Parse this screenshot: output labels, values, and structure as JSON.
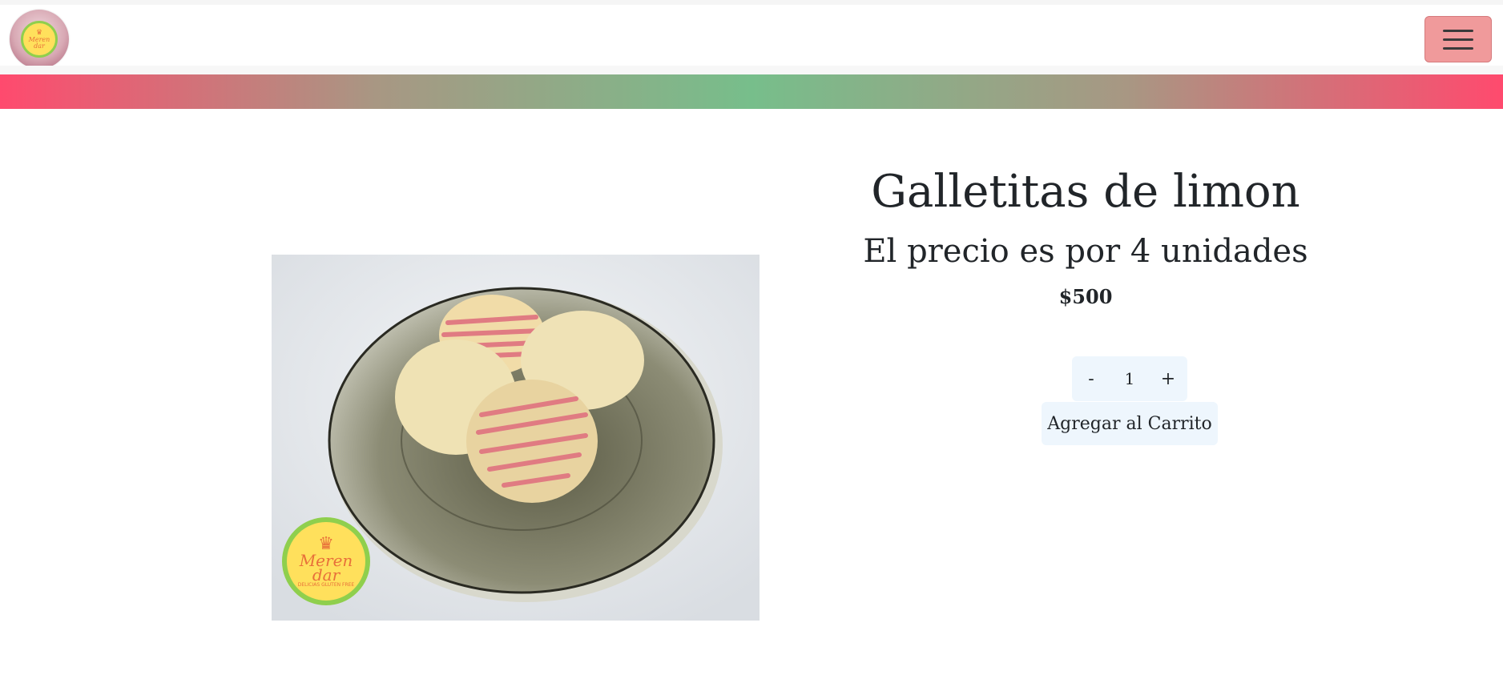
{
  "navbar": {
    "logo_icon": "merendar-logo-icon",
    "logo_text": "Meren dar",
    "menu_icon": "hamburger-menu-icon"
  },
  "product": {
    "title": "Galletitas de limon",
    "subtitle": "El precio es por 4 unidades",
    "price": "$500",
    "watermark_text": "Meren dar",
    "watermark_subtext": "DELICIAS GLUTEN FREE"
  },
  "quantity": {
    "minus_label": "-",
    "value": "1",
    "plus_label": "+"
  },
  "cart": {
    "add_label": "Agregar al Carrito"
  },
  "colors": {
    "gradient_pink": "#ff4a6e",
    "gradient_green": "#77be8b",
    "toggler_bg": "#f09a9b",
    "control_bg": "#eef6fd",
    "logo_yellow": "#ffe05c",
    "logo_green": "#8fcf4d"
  }
}
